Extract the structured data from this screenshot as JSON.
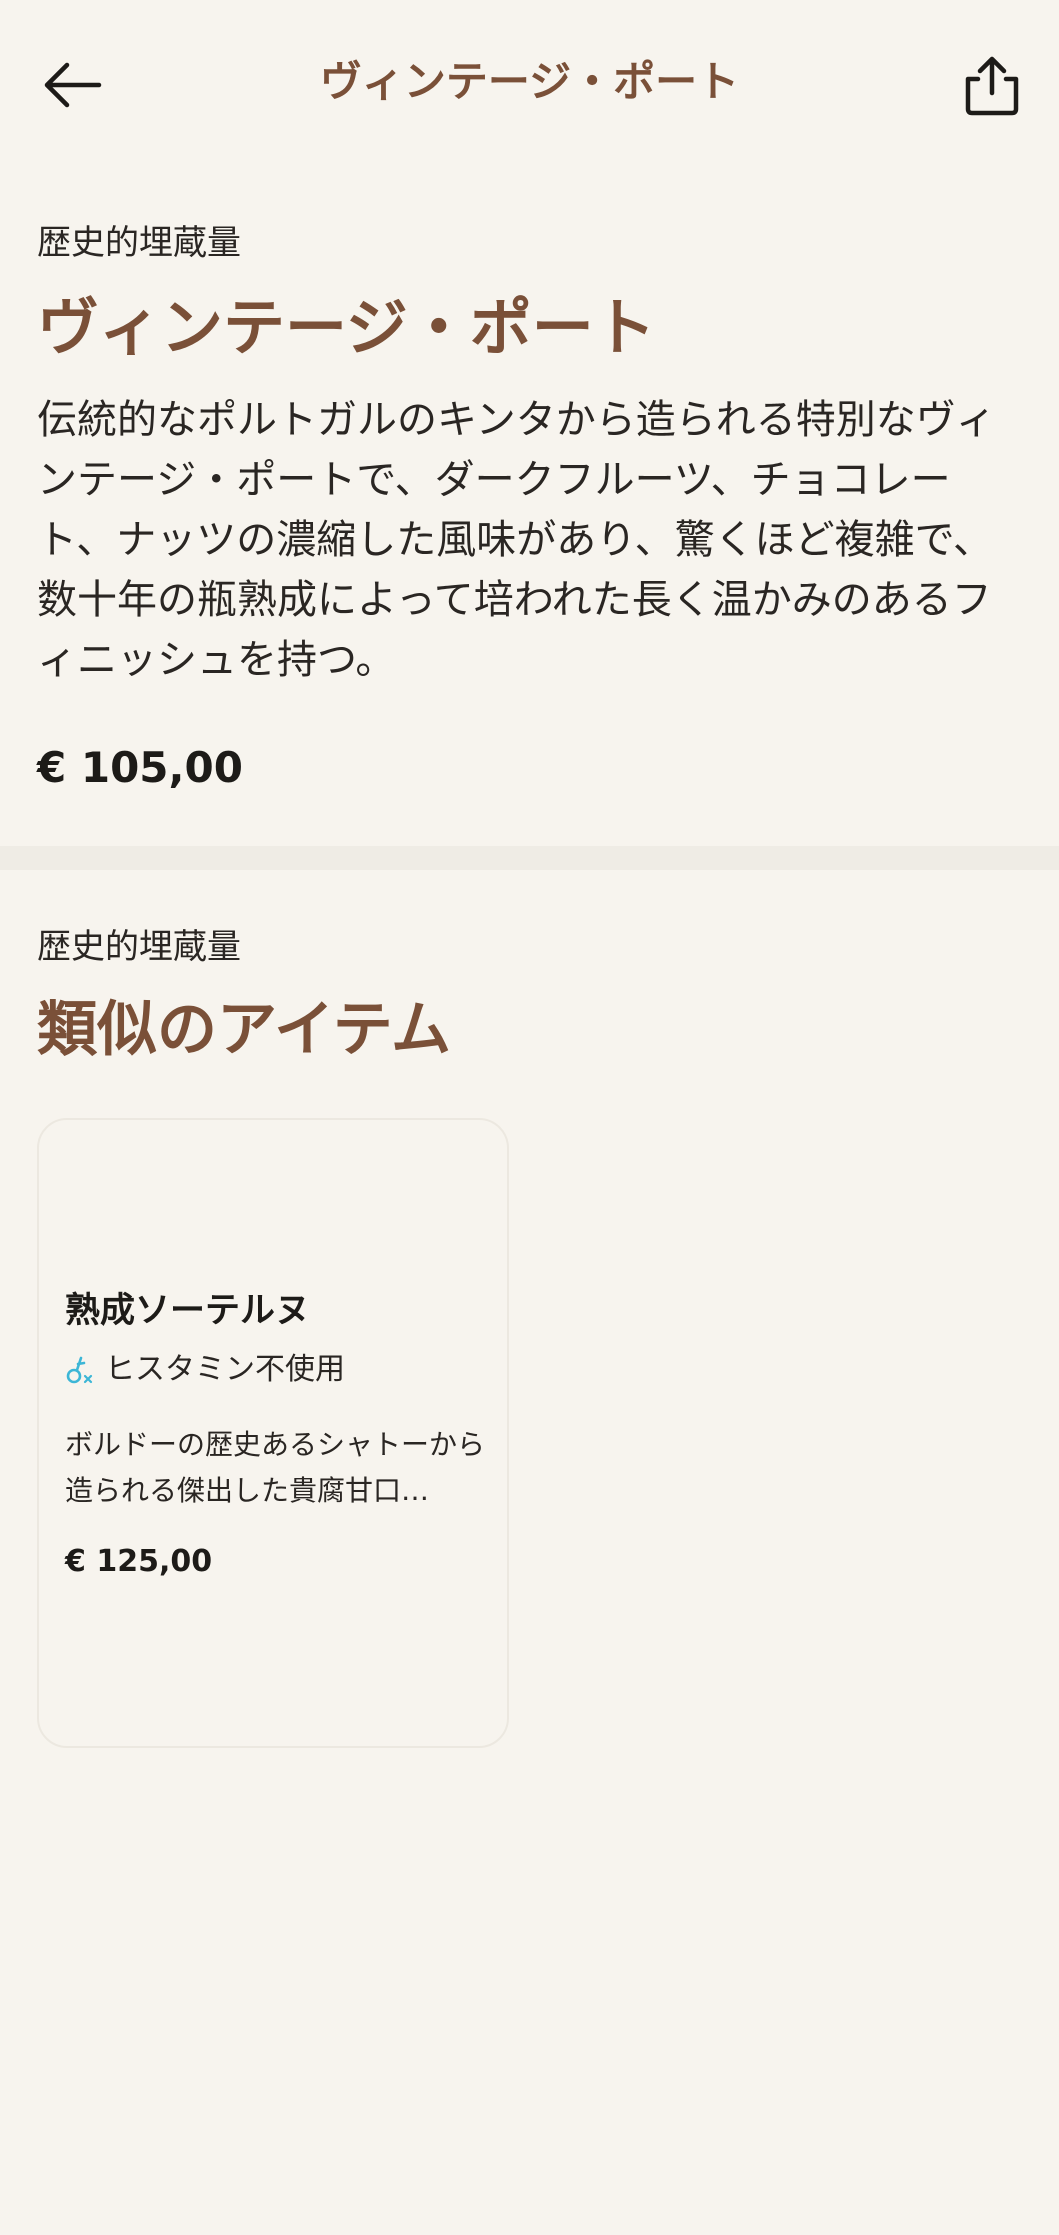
{
  "header": {
    "title": "ヴィンテージ・ポート",
    "back_icon": "arrow-left-icon",
    "share_icon": "share-icon"
  },
  "product": {
    "category": "歴史的埋蔵量",
    "name": "ヴィンテージ・ポート",
    "description": "伝統的なポルトガルのキンタから造られる特別なヴィンテージ・ポートで、ダークフルーツ、チョコレート、ナッツの濃縮した風味があり、驚くほど複雑で、数十年の瓶熟成によって培われた長く温かみのあるフィニッシュを持つ。",
    "price": "€ 105,00"
  },
  "similar": {
    "category": "歴史的埋蔵量",
    "title": "類似のアイテム",
    "items": [
      {
        "name": "熟成ソーテルヌ",
        "tag_icon": "histamine-free-icon",
        "tag": "ヒスタミン不使用",
        "description": "ボルドーの歴史あるシャトーから造られる傑出した貴腐甘口…",
        "price": "€ 125,00"
      }
    ]
  },
  "colors": {
    "background": "#f7f4ee",
    "accent": "#7a5038",
    "divider": "#efece5",
    "tag_icon": "#3cb6d6",
    "text": "#1d1b18"
  }
}
